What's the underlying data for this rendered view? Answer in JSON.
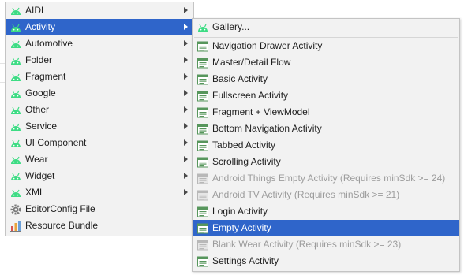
{
  "left_menu": {
    "items": [
      {
        "label": "AIDL",
        "icon": "android-icon",
        "submenu": true
      },
      {
        "label": "Activity",
        "icon": "android-icon",
        "submenu": true,
        "selected": true
      },
      {
        "label": "Automotive",
        "icon": "android-icon",
        "submenu": true
      },
      {
        "label": "Folder",
        "icon": "android-icon",
        "submenu": true
      },
      {
        "label": "Fragment",
        "icon": "android-icon",
        "submenu": true
      },
      {
        "label": "Google",
        "icon": "android-icon",
        "submenu": true
      },
      {
        "label": "Other",
        "icon": "android-icon",
        "submenu": true
      },
      {
        "label": "Service",
        "icon": "android-icon",
        "submenu": true
      },
      {
        "label": "UI Component",
        "icon": "android-icon",
        "submenu": true
      },
      {
        "label": "Wear",
        "icon": "android-icon",
        "submenu": true
      },
      {
        "label": "Widget",
        "icon": "android-icon",
        "submenu": true
      },
      {
        "label": "XML",
        "icon": "android-icon",
        "submenu": true
      },
      {
        "label": "EditorConfig File",
        "icon": "gear-icon",
        "submenu": false
      },
      {
        "label": "Resource Bundle",
        "icon": "bar-chart-icon",
        "submenu": false
      }
    ]
  },
  "right_menu": {
    "gallery_label": "Gallery...",
    "items": [
      {
        "label": "Navigation Drawer Activity",
        "enabled": true
      },
      {
        "label": "Master/Detail Flow",
        "enabled": true
      },
      {
        "label": "Basic Activity",
        "enabled": true
      },
      {
        "label": "Fullscreen Activity",
        "enabled": true
      },
      {
        "label": "Fragment + ViewModel",
        "enabled": true
      },
      {
        "label": "Bottom Navigation Activity",
        "enabled": true
      },
      {
        "label": "Tabbed Activity",
        "enabled": true
      },
      {
        "label": "Scrolling Activity",
        "enabled": true
      },
      {
        "label": "Android Things Empty Activity (Requires minSdk >= 24)",
        "enabled": false
      },
      {
        "label": "Android TV Activity (Requires minSdk >= 21)",
        "enabled": false
      },
      {
        "label": "Login Activity",
        "enabled": true
      },
      {
        "label": "Empty Activity",
        "enabled": true,
        "selected": true
      },
      {
        "label": "Blank Wear Activity (Requires minSdk >= 23)",
        "enabled": false
      },
      {
        "label": "Settings Activity",
        "enabled": true
      }
    ]
  },
  "colors": {
    "selection": "#2f65ca",
    "android_green": "#3ddc84",
    "template_green": "#57965c",
    "disabled_text": "#9c9c9c"
  }
}
